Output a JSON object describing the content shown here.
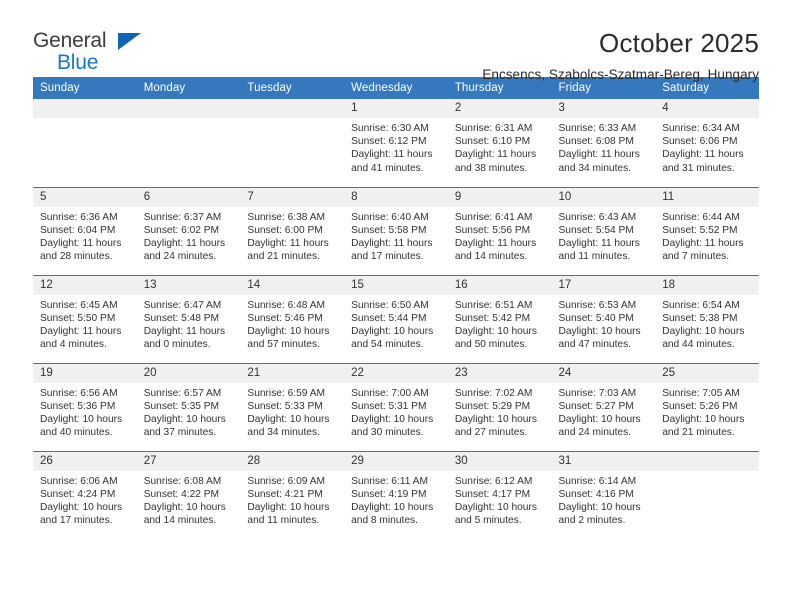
{
  "logo": {
    "word_one": "General",
    "word_two": "Blue",
    "triangle_color": "#1166b4",
    "blue_color": "#1878c8"
  },
  "header": {
    "title": "October 2025",
    "subtitle": "Encsencs, Szabolcs-Szatmar-Bereg, Hungary"
  },
  "theme": {
    "header_bg": "#3578bd",
    "header_text": "#ffffff",
    "daynum_bg": "#f0f0f0",
    "row_divider": "#3578bd",
    "body_text": "#333333"
  },
  "weekday_headers": [
    "Sunday",
    "Monday",
    "Tuesday",
    "Wednesday",
    "Thursday",
    "Friday",
    "Saturday"
  ],
  "weeks": [
    [
      {
        "day": ""
      },
      {
        "day": ""
      },
      {
        "day": ""
      },
      {
        "day": "1",
        "sunrise": "Sunrise: 6:30 AM",
        "sunset": "Sunset: 6:12 PM",
        "daylight_1": "Daylight: 11 hours",
        "daylight_2": "and 41 minutes."
      },
      {
        "day": "2",
        "sunrise": "Sunrise: 6:31 AM",
        "sunset": "Sunset: 6:10 PM",
        "daylight_1": "Daylight: 11 hours",
        "daylight_2": "and 38 minutes."
      },
      {
        "day": "3",
        "sunrise": "Sunrise: 6:33 AM",
        "sunset": "Sunset: 6:08 PM",
        "daylight_1": "Daylight: 11 hours",
        "daylight_2": "and 34 minutes."
      },
      {
        "day": "4",
        "sunrise": "Sunrise: 6:34 AM",
        "sunset": "Sunset: 6:06 PM",
        "daylight_1": "Daylight: 11 hours",
        "daylight_2": "and 31 minutes."
      }
    ],
    [
      {
        "day": "5",
        "sunrise": "Sunrise: 6:36 AM",
        "sunset": "Sunset: 6:04 PM",
        "daylight_1": "Daylight: 11 hours",
        "daylight_2": "and 28 minutes."
      },
      {
        "day": "6",
        "sunrise": "Sunrise: 6:37 AM",
        "sunset": "Sunset: 6:02 PM",
        "daylight_1": "Daylight: 11 hours",
        "daylight_2": "and 24 minutes."
      },
      {
        "day": "7",
        "sunrise": "Sunrise: 6:38 AM",
        "sunset": "Sunset: 6:00 PM",
        "daylight_1": "Daylight: 11 hours",
        "daylight_2": "and 21 minutes."
      },
      {
        "day": "8",
        "sunrise": "Sunrise: 6:40 AM",
        "sunset": "Sunset: 5:58 PM",
        "daylight_1": "Daylight: 11 hours",
        "daylight_2": "and 17 minutes."
      },
      {
        "day": "9",
        "sunrise": "Sunrise: 6:41 AM",
        "sunset": "Sunset: 5:56 PM",
        "daylight_1": "Daylight: 11 hours",
        "daylight_2": "and 14 minutes."
      },
      {
        "day": "10",
        "sunrise": "Sunrise: 6:43 AM",
        "sunset": "Sunset: 5:54 PM",
        "daylight_1": "Daylight: 11 hours",
        "daylight_2": "and 11 minutes."
      },
      {
        "day": "11",
        "sunrise": "Sunrise: 6:44 AM",
        "sunset": "Sunset: 5:52 PM",
        "daylight_1": "Daylight: 11 hours",
        "daylight_2": "and 7 minutes."
      }
    ],
    [
      {
        "day": "12",
        "sunrise": "Sunrise: 6:45 AM",
        "sunset": "Sunset: 5:50 PM",
        "daylight_1": "Daylight: 11 hours",
        "daylight_2": "and 4 minutes."
      },
      {
        "day": "13",
        "sunrise": "Sunrise: 6:47 AM",
        "sunset": "Sunset: 5:48 PM",
        "daylight_1": "Daylight: 11 hours",
        "daylight_2": "and 0 minutes."
      },
      {
        "day": "14",
        "sunrise": "Sunrise: 6:48 AM",
        "sunset": "Sunset: 5:46 PM",
        "daylight_1": "Daylight: 10 hours",
        "daylight_2": "and 57 minutes."
      },
      {
        "day": "15",
        "sunrise": "Sunrise: 6:50 AM",
        "sunset": "Sunset: 5:44 PM",
        "daylight_1": "Daylight: 10 hours",
        "daylight_2": "and 54 minutes."
      },
      {
        "day": "16",
        "sunrise": "Sunrise: 6:51 AM",
        "sunset": "Sunset: 5:42 PM",
        "daylight_1": "Daylight: 10 hours",
        "daylight_2": "and 50 minutes."
      },
      {
        "day": "17",
        "sunrise": "Sunrise: 6:53 AM",
        "sunset": "Sunset: 5:40 PM",
        "daylight_1": "Daylight: 10 hours",
        "daylight_2": "and 47 minutes."
      },
      {
        "day": "18",
        "sunrise": "Sunrise: 6:54 AM",
        "sunset": "Sunset: 5:38 PM",
        "daylight_1": "Daylight: 10 hours",
        "daylight_2": "and 44 minutes."
      }
    ],
    [
      {
        "day": "19",
        "sunrise": "Sunrise: 6:56 AM",
        "sunset": "Sunset: 5:36 PM",
        "daylight_1": "Daylight: 10 hours",
        "daylight_2": "and 40 minutes."
      },
      {
        "day": "20",
        "sunrise": "Sunrise: 6:57 AM",
        "sunset": "Sunset: 5:35 PM",
        "daylight_1": "Daylight: 10 hours",
        "daylight_2": "and 37 minutes."
      },
      {
        "day": "21",
        "sunrise": "Sunrise: 6:59 AM",
        "sunset": "Sunset: 5:33 PM",
        "daylight_1": "Daylight: 10 hours",
        "daylight_2": "and 34 minutes."
      },
      {
        "day": "22",
        "sunrise": "Sunrise: 7:00 AM",
        "sunset": "Sunset: 5:31 PM",
        "daylight_1": "Daylight: 10 hours",
        "daylight_2": "and 30 minutes."
      },
      {
        "day": "23",
        "sunrise": "Sunrise: 7:02 AM",
        "sunset": "Sunset: 5:29 PM",
        "daylight_1": "Daylight: 10 hours",
        "daylight_2": "and 27 minutes."
      },
      {
        "day": "24",
        "sunrise": "Sunrise: 7:03 AM",
        "sunset": "Sunset: 5:27 PM",
        "daylight_1": "Daylight: 10 hours",
        "daylight_2": "and 24 minutes."
      },
      {
        "day": "25",
        "sunrise": "Sunrise: 7:05 AM",
        "sunset": "Sunset: 5:26 PM",
        "daylight_1": "Daylight: 10 hours",
        "daylight_2": "and 21 minutes."
      }
    ],
    [
      {
        "day": "26",
        "sunrise": "Sunrise: 6:06 AM",
        "sunset": "Sunset: 4:24 PM",
        "daylight_1": "Daylight: 10 hours",
        "daylight_2": "and 17 minutes."
      },
      {
        "day": "27",
        "sunrise": "Sunrise: 6:08 AM",
        "sunset": "Sunset: 4:22 PM",
        "daylight_1": "Daylight: 10 hours",
        "daylight_2": "and 14 minutes."
      },
      {
        "day": "28",
        "sunrise": "Sunrise: 6:09 AM",
        "sunset": "Sunset: 4:21 PM",
        "daylight_1": "Daylight: 10 hours",
        "daylight_2": "and 11 minutes."
      },
      {
        "day": "29",
        "sunrise": "Sunrise: 6:11 AM",
        "sunset": "Sunset: 4:19 PM",
        "daylight_1": "Daylight: 10 hours",
        "daylight_2": "and 8 minutes."
      },
      {
        "day": "30",
        "sunrise": "Sunrise: 6:12 AM",
        "sunset": "Sunset: 4:17 PM",
        "daylight_1": "Daylight: 10 hours",
        "daylight_2": "and 5 minutes."
      },
      {
        "day": "31",
        "sunrise": "Sunrise: 6:14 AM",
        "sunset": "Sunset: 4:16 PM",
        "daylight_1": "Daylight: 10 hours",
        "daylight_2": "and 2 minutes."
      },
      {
        "day": ""
      }
    ]
  ]
}
